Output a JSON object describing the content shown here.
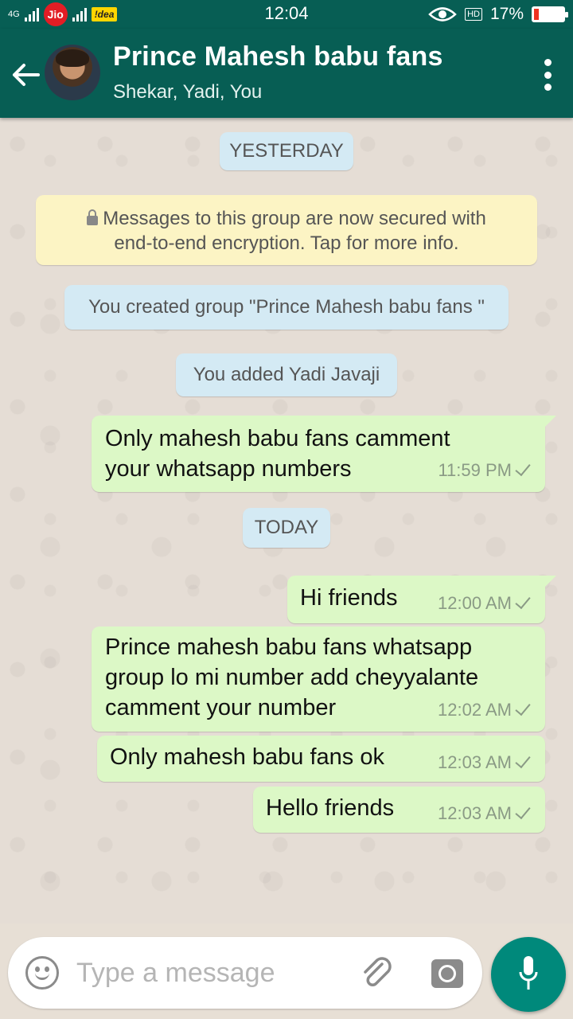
{
  "status_bar": {
    "network_label": "4G",
    "carrier1": "Jio",
    "carrier2": "!dea",
    "time": "12:04",
    "hd_label": "HD",
    "battery": "17%",
    "battery_level": 0.17
  },
  "header": {
    "title": "Prince Mahesh babu fans",
    "subtitle": "Shekar, Yadi, You"
  },
  "chat": {
    "date_yesterday": "YESTERDAY",
    "encryption_line1": "Messages to this group are now secured with",
    "encryption_line2": "end-to-end encryption. Tap for more info.",
    "system_created": "You created group \"Prince Mahesh babu fans \"",
    "system_added": "You added Yadi Javaji",
    "date_today": "TODAY",
    "messages": [
      {
        "line1": "Only mahesh babu fans camment",
        "line2": "your whatsapp numbers",
        "time": "11:59 PM"
      },
      {
        "line1": "Hi friends",
        "time": "12:00 AM"
      },
      {
        "line1": "Prince mahesh babu fans whatsapp",
        "line2": "group lo mi number add cheyyalante",
        "line3": "camment your number",
        "time": "12:02 AM"
      },
      {
        "line1": "Only mahesh babu fans ok",
        "time": "12:03 AM"
      },
      {
        "line1": "Hello friends",
        "time": "12:03 AM"
      }
    ]
  },
  "input": {
    "placeholder": "Type a message",
    "value": ""
  },
  "icons": {
    "back": "arrow-left-icon",
    "more": "more-vert-icon",
    "emoji": "emoji-icon",
    "attach": "paperclip-icon",
    "camera": "camera-icon",
    "mic": "mic-icon"
  },
  "colors": {
    "primary": "#075e54",
    "outgoing_bubble": "#dcf8c6",
    "system_pill": "#d4eaf4",
    "encryption_notice": "#fcf4c4",
    "fab": "#00897b"
  }
}
